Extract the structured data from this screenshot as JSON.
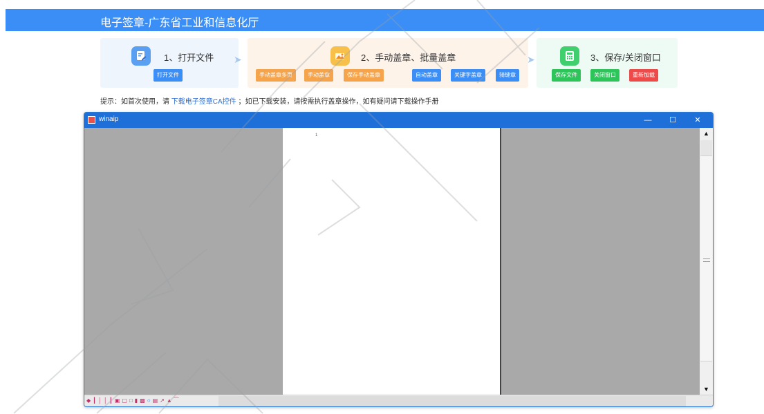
{
  "header": {
    "title": "电子签章-广东省工业和信息化厅"
  },
  "steps": {
    "step1": {
      "title": "1、打开文件",
      "buttons": [
        "打开文件"
      ]
    },
    "step2": {
      "title": "2、手动盖章、批量盖章",
      "buttons": [
        "手动盖章多页",
        "手动盖章",
        "保存手动盖章",
        "自动盖章",
        "关键字盖章",
        "骑缝章"
      ]
    },
    "step3": {
      "title": "3、保存/关闭窗口",
      "buttons": [
        "保存文件",
        "关闭窗口",
        "重新加载"
      ]
    }
  },
  "hint": {
    "prefix": "提示：如首次使用，请",
    "link": "下载电子签章CA控件",
    "suffix": "；如已下载安装，请按需执行盖章操作，如有疑问请下载操作手册"
  },
  "window": {
    "title": "winaip",
    "controls": {
      "minimize": "—",
      "maximize": "☐",
      "close": "✕"
    },
    "page_number": "1",
    "scroll_up": "▲",
    "scroll_down": "▼"
  },
  "colors": {
    "accent": "#3a8ef5",
    "orange": "#f6a44c",
    "green": "#2dc45a",
    "red": "#ef4a4a"
  },
  "icons": [
    "edit-icon",
    "stamp-icon",
    "calculator-icon",
    "step-arrow-icon"
  ]
}
